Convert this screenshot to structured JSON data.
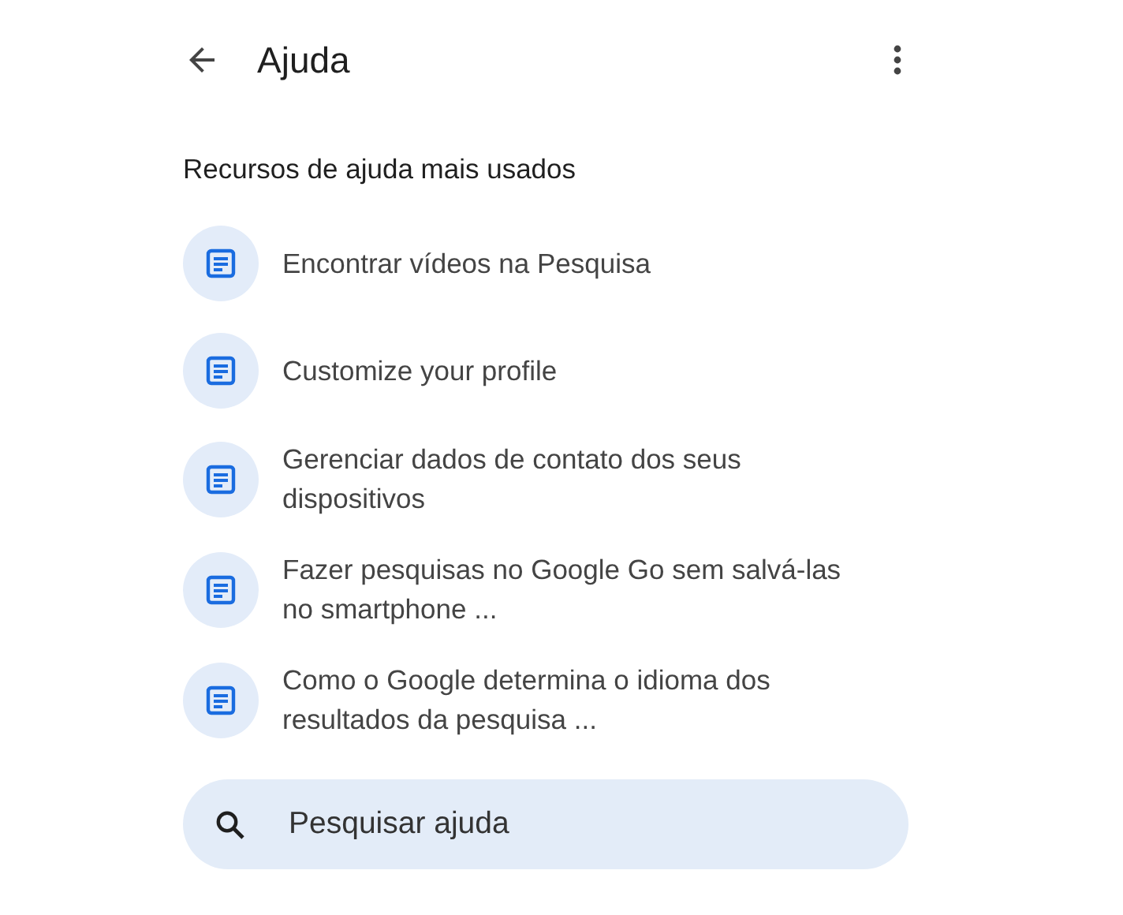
{
  "header": {
    "title": "Ajuda"
  },
  "section": {
    "heading": "Recursos de ajuda mais usados"
  },
  "items": [
    {
      "kind": "article",
      "label": "Encontrar vídeos na Pesquisa"
    },
    {
      "kind": "article",
      "label": "Customize your profile"
    },
    {
      "kind": "article",
      "label": "Gerenciar dados de contato dos seus dispositivos"
    },
    {
      "kind": "article",
      "label": "Fazer pesquisas no Google Go sem salvá-las no smartphone ..."
    },
    {
      "kind": "article",
      "label": "Como o Google determina o idioma dos resultados da pesquisa ..."
    }
  ],
  "search": {
    "placeholder": "Pesquisar ajuda"
  }
}
